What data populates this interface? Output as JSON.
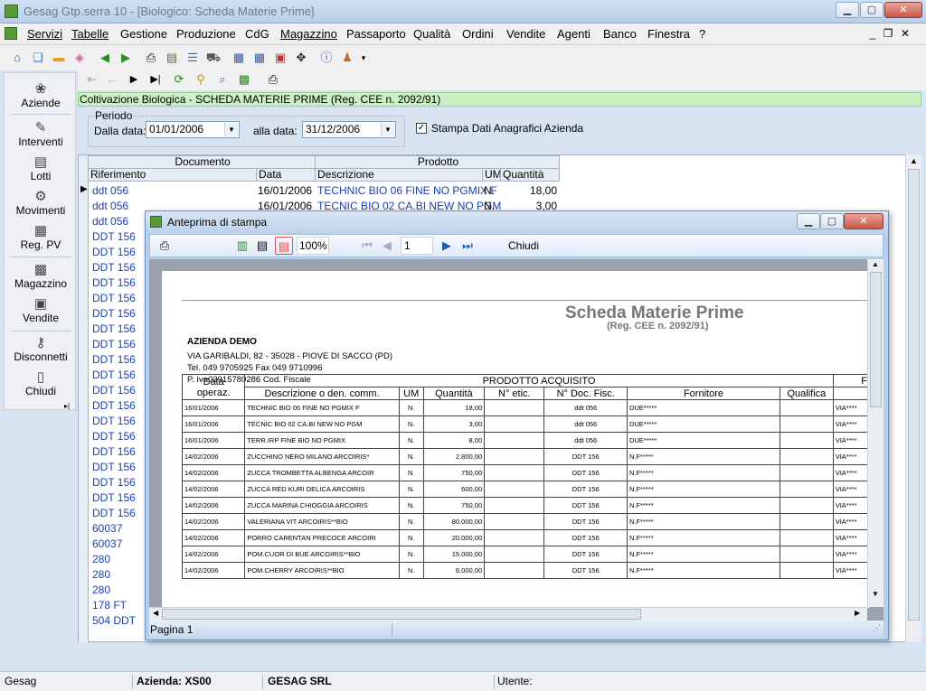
{
  "window": {
    "title": "Gesag Gtp.serra 10 - [Biologico: Scheda Materie Prime]"
  },
  "menu": [
    "Servizi",
    "Tabelle",
    "Gestione",
    "Produzione",
    "CdG",
    "Magazzino",
    "Passaporto",
    "Qualità",
    "Ordini",
    "Vendite",
    "Agenti",
    "Banco",
    "Finestra",
    "?"
  ],
  "sidebar": [
    "Aziende",
    "Interventi",
    "Lotti",
    "Movimenti",
    "Reg. PV",
    "Magazzino",
    "Vendite",
    "Disconnetti",
    "Chiudi"
  ],
  "banner": "Coltivazione Biologica - SCHEDA MATERIE PRIME (Reg. CEE n. 2092/91)",
  "periodo": {
    "legend": "Periodo",
    "from_label": "Dalla data:",
    "from_value": "01/01/2006",
    "to_label": "alla data:",
    "to_value": "31/12/2006"
  },
  "stampa_label": "Stampa Dati Anagrafici Azienda",
  "grid": {
    "group_documento": "Documento",
    "group_prodotto": "Prodotto",
    "columns": [
      "Riferimento",
      "Data",
      "Descrizione",
      "UM",
      "Quantità"
    ],
    "rows": [
      {
        "rif": "ddt 056",
        "data": "16/01/2006",
        "desc": "TECHNIC BIO 06 FINE NO PGMIX F",
        "um": "N.",
        "qta": "18,00"
      },
      {
        "rif": "ddt 056",
        "data": "16/01/2006",
        "desc": "TECNIC BIO 02 CA.BI NEW NO PGM",
        "um": "N.",
        "qta": "3,00"
      },
      {
        "rif": "ddt 056"
      },
      {
        "rif": "DDT 156"
      },
      {
        "rif": "DDT 156"
      },
      {
        "rif": "DDT 156"
      },
      {
        "rif": "DDT 156"
      },
      {
        "rif": "DDT 156"
      },
      {
        "rif": "DDT 156"
      },
      {
        "rif": "DDT 156"
      },
      {
        "rif": "DDT 156"
      },
      {
        "rif": "DDT 156"
      },
      {
        "rif": "DDT 156"
      },
      {
        "rif": "DDT 156"
      },
      {
        "rif": "DDT 156"
      },
      {
        "rif": "DDT 156"
      },
      {
        "rif": "DDT 156"
      },
      {
        "rif": "DDT 156"
      },
      {
        "rif": "DDT 156"
      },
      {
        "rif": "DDT 156"
      },
      {
        "rif": "DDT 156"
      },
      {
        "rif": "DDT 156"
      },
      {
        "rif": "60037"
      },
      {
        "rif": "60037"
      },
      {
        "rif": "280"
      },
      {
        "rif": "280"
      },
      {
        "rif": "280"
      },
      {
        "rif": "178 FT"
      },
      {
        "rif": "504 DDT"
      }
    ]
  },
  "preview": {
    "title": "Anteprima di stampa",
    "zoom": "100%",
    "page": "1",
    "close": "Chiudi",
    "status": "Pagina 1",
    "report": {
      "title": "Scheda Materie Prime",
      "subtitle": "(Reg. CEE n. 2092/91)",
      "company": "AZIENDA DEMO",
      "address": "VIA GARIBALDI, 82 - 35028 - PIOVE DI SACCO (PD)",
      "phone": "Tel. 049 9705925   Fax 049 9710996",
      "vat": "P. Iva03915780286 Cod. Fiscale",
      "col_data": "Data",
      "col_oper": "operaz.",
      "group": "PRODOTTO ACQUISITO",
      "cols": [
        "Descrizione o den. comm.",
        "UM",
        "Quantità",
        "N° etic.",
        "N° Doc. Fisc.",
        "Fornitore",
        "Qualifica"
      ],
      "extra_head": "F",
      "rows": [
        [
          "16/01/2006",
          "TECHNIC BIO 06 FINE NO PGMIX F",
          "N.",
          "18,00",
          "",
          "ddt 056",
          "DUE*****",
          "",
          "VIA****"
        ],
        [
          "16/01/2006",
          "TECNIC BIO 02 CA.BI NEW NO PGM",
          "N.",
          "3,00",
          "",
          "ddt 056",
          "DUE*****",
          "",
          "VIA****"
        ],
        [
          "16/01/2006",
          "TERR.IRP FINE BIO NO PGMIX",
          "N.",
          "8,00",
          "",
          "ddt 056",
          "DUE*****",
          "",
          "VIA****"
        ],
        [
          "14/02/2006",
          "ZUCCHINO NERO MILANO ARCOIRIS*",
          "N.",
          "2.800,00",
          "",
          "DDT 156",
          "N.F*****",
          "",
          "VIA****"
        ],
        [
          "14/02/2006",
          "ZUCCA TROMBETTA ALBENGA ARCOIR",
          "N.",
          "750,00",
          "",
          "DDT 156",
          "N.F*****",
          "",
          "VIA****"
        ],
        [
          "14/02/2006",
          "ZUCCA RED KURI DELICA ARCOIRIS",
          "N.",
          "600,00",
          "",
          "DDT 156",
          "N.F*****",
          "",
          "VIA****"
        ],
        [
          "14/02/2006",
          "ZUCCA MARINA CHIOGGIA ARCOIRIS",
          "N.",
          "750,00",
          "",
          "DDT 156",
          "N.F*****",
          "",
          "VIA****"
        ],
        [
          "14/02/2006",
          "VALERIANA VIT ARCOIRIS**BIO",
          "N.",
          "80.000,00",
          "",
          "DDT 156",
          "N.F*****",
          "",
          "VIA****"
        ],
        [
          "14/02/2006",
          "PORRO CARENTAN PRECOCE ARCOIRI",
          "N.",
          "20.000,00",
          "",
          "DDT 156",
          "N.F*****",
          "",
          "VIA****"
        ],
        [
          "14/02/2006",
          "POM.CUOR DI BUE ARCOIRIS**BIO",
          "N.",
          "15.000,00",
          "",
          "DDT 156",
          "N.F*****",
          "",
          "VIA****"
        ],
        [
          "14/02/2006",
          "POM.CHERRY ARCOIRIS**BIO",
          "N.",
          "6.000,00",
          "",
          "DDT 156",
          "N.F*****",
          "",
          "VIA****"
        ]
      ]
    }
  },
  "status": {
    "app": "Gesag",
    "azienda": "Azienda: XS00",
    "ditta": "GESAG SRL",
    "utente": "Utente:"
  }
}
